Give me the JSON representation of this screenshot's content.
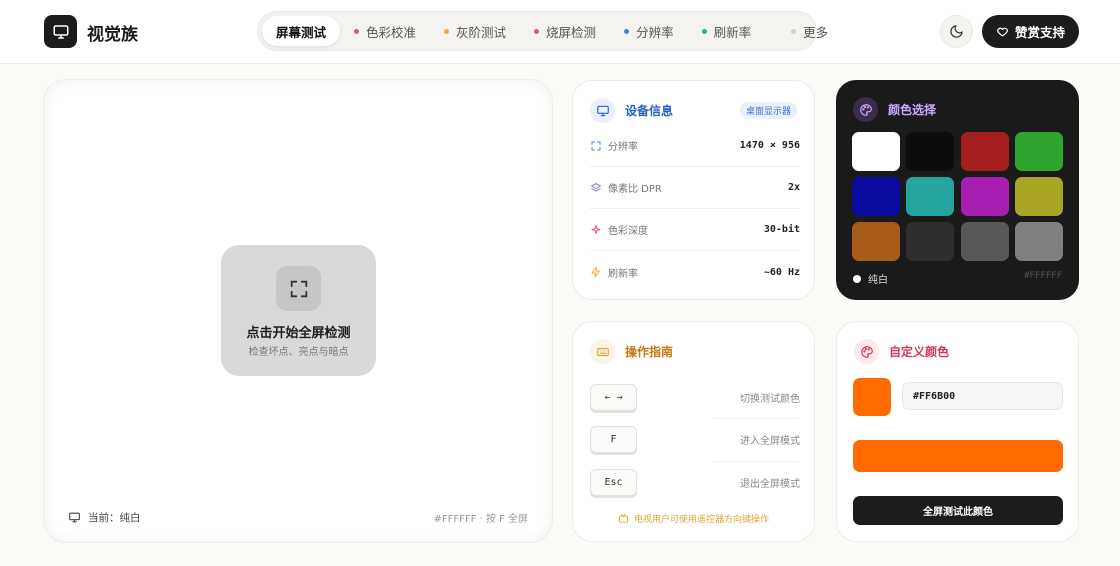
{
  "header": {
    "brand": "视觉族",
    "nav": [
      {
        "label": "屏幕测试",
        "dot": "",
        "active": true
      },
      {
        "label": "色彩校准",
        "dot": "#e0517b"
      },
      {
        "label": "灰阶测试",
        "dot": "#f0a93a"
      },
      {
        "label": "烧屏检测",
        "dot": "#e0517b"
      },
      {
        "label": "分辨率",
        "dot": "#3f7fe0"
      },
      {
        "label": "刷新率",
        "dot": "#1fb58a"
      },
      {
        "label": "更多",
        "dot": "#cfcfcf"
      }
    ],
    "support_label": "赞赏支持"
  },
  "test_panel": {
    "start_title": "点击开始全屏检测",
    "start_subtitle": "检查坏点、亮点与暗点",
    "current_label": "当前：纯白",
    "hint": "#FFFFFF · 按 F 全屏"
  },
  "device_info": {
    "title": "设备信息",
    "badge": "桌面显示器",
    "rows": [
      {
        "label": "分辨率",
        "value": "1470 × 956",
        "icon": "fullscreen-icon",
        "color": "#4a86e8"
      },
      {
        "label": "像素比 DPR",
        "value": "2x",
        "icon": "layers-icon",
        "color": "#8a6fd6"
      },
      {
        "label": "色彩深度",
        "value": "30-bit",
        "icon": "sparkle-icon",
        "color": "#e0517b"
      },
      {
        "label": "刷新率",
        "value": "~60 Hz",
        "icon": "bolt-icon",
        "color": "#f0a93a"
      }
    ]
  },
  "color_picker": {
    "title": "颜色选择",
    "swatches": [
      "#ffffff",
      "#0d0d0d",
      "#a51d1d",
      "#2fa52f",
      "#0b0ba0",
      "#25a4a0",
      "#a81eb0",
      "#a8a624",
      "#a85b18",
      "#2e2e2e",
      "#585858",
      "#808080"
    ],
    "current_name": "纯白",
    "current_hex": "#FFFFFF"
  },
  "guide": {
    "title": "操作指南",
    "keys": [
      {
        "key": "← →",
        "desc": "切换测试颜色"
      },
      {
        "key": "F",
        "desc": "进入全屏模式"
      },
      {
        "key": "Esc",
        "desc": "退出全屏模式"
      }
    ],
    "tv_tip": "电视用户可使用遥控器方向键操作"
  },
  "custom_color": {
    "title": "自定义颜色",
    "hex_value": "#FF6B00",
    "color": "#ff6b00",
    "button_label": "全屏测试此颜色"
  }
}
